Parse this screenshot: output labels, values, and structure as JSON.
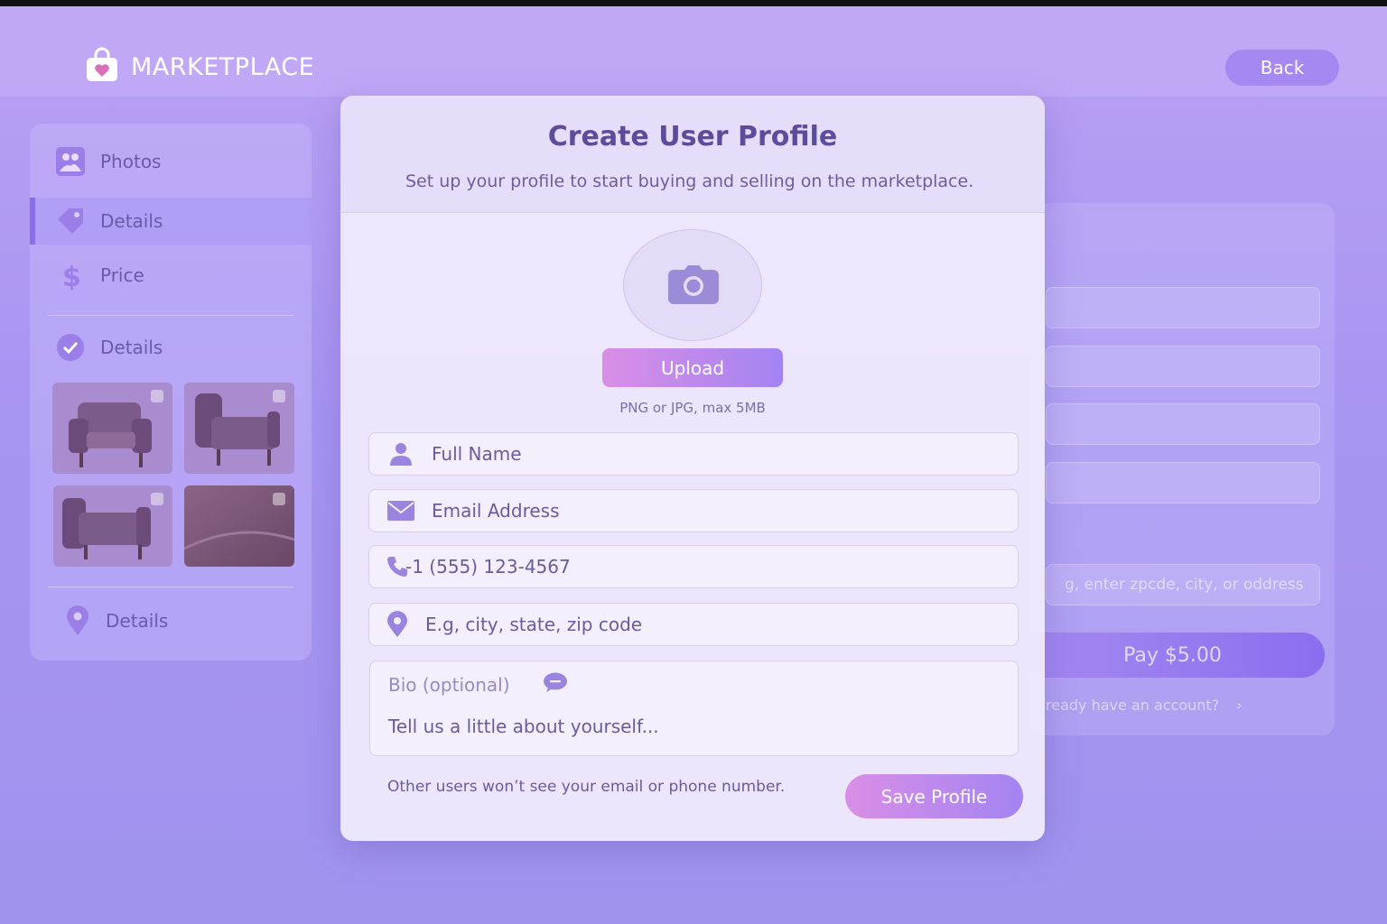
{
  "app": {
    "brand": "MARKETPLACE",
    "back_label": "Back"
  },
  "sidebar": {
    "items": [
      {
        "label": "Photos",
        "icon": "photo-icon"
      },
      {
        "label": "Details",
        "icon": "tag-icon",
        "active": true
      },
      {
        "label": "Price",
        "icon": "dollar-icon"
      },
      {
        "label": "Details",
        "icon": "check-circle-icon"
      },
      {
        "label": "Details",
        "icon": "location-pin-icon"
      }
    ],
    "thumbnails": [
      "armchair-front",
      "armchair-side",
      "armchair-angle",
      "leather-closeup"
    ]
  },
  "background_form": {
    "location_placeholder": "g, enter zpcde, city, or oddress",
    "pay_label": "Pay $5.00",
    "account_text": "ready have an account?",
    "account_chevron": "›"
  },
  "modal": {
    "title": "Create User Profile",
    "subtitle": "Set up your profile to start buying and selling on the marketplace.",
    "upload_label": "Upload",
    "upload_hint": "PNG or JPG, max 5MB",
    "fields": {
      "full_name": "Full Name",
      "email": "Email Address",
      "phone": "-1  (555) 123-4567",
      "location": "E.g, city, state, zip code"
    },
    "bio_label": "Bio (optional)",
    "bio_placeholder": "Tell us a little about yourself...",
    "privacy_note": "Other users won’t see your email or phone number.",
    "save_label": "Save Profile"
  },
  "colors": {
    "accent": "#8a6ee8",
    "button_start": "#d98ee6",
    "button_end": "#a384f2"
  }
}
